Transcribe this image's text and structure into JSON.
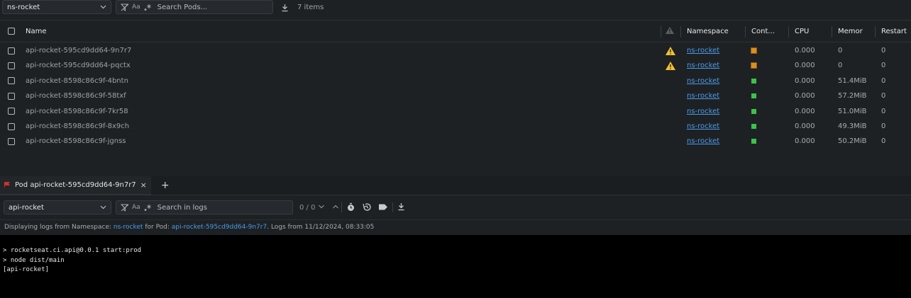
{
  "top_toolbar": {
    "namespace_select": "ns-rocket",
    "search_placeholder": "Search Pods...",
    "aa_label": "Aa",
    "items_count": "7 items"
  },
  "table": {
    "columns": {
      "name": "Name",
      "namespace": "Namespace",
      "containers": "Cont...",
      "cpu": "CPU",
      "memory": "Memor",
      "restart": "Restart"
    },
    "rows": [
      {
        "name": "api-rocket-595cd9dd64-9n7r7",
        "warning": true,
        "namespace": "ns-rocket",
        "status": "pending",
        "cpu": "0.000",
        "memory": "0",
        "restart": "0"
      },
      {
        "name": "api-rocket-595cd9dd64-pqctx",
        "warning": true,
        "namespace": "ns-rocket",
        "status": "pending",
        "cpu": "0.000",
        "memory": "0",
        "restart": "0"
      },
      {
        "name": "api-rocket-8598c86c9f-4bntn",
        "warning": false,
        "namespace": "ns-rocket",
        "status": "running",
        "cpu": "0.000",
        "memory": "51.4MiB",
        "restart": "0"
      },
      {
        "name": "api-rocket-8598c86c9f-58txf",
        "warning": false,
        "namespace": "ns-rocket",
        "status": "running",
        "cpu": "0.000",
        "memory": "57.2MiB",
        "restart": "0"
      },
      {
        "name": "api-rocket-8598c86c9f-7kr58",
        "warning": false,
        "namespace": "ns-rocket",
        "status": "running",
        "cpu": "0.000",
        "memory": "51.0MiB",
        "restart": "0"
      },
      {
        "name": "api-rocket-8598c86c9f-8x9ch",
        "warning": false,
        "namespace": "ns-rocket",
        "status": "running",
        "cpu": "0.000",
        "memory": "49.3MiB",
        "restart": "0"
      },
      {
        "name": "api-rocket-8598c86c9f-jgnss",
        "warning": false,
        "namespace": "ns-rocket",
        "status": "running",
        "cpu": "0.000",
        "memory": "50.2MiB",
        "restart": "0"
      }
    ]
  },
  "colors": {
    "pending": "#d9901f",
    "running": "#3cc34a",
    "warning": "#f2c12e",
    "link": "#4a9be8",
    "tab_flag": "#d03030"
  },
  "dock": {
    "tab_label": "Pod api-rocket-595cd9dd64-9n7r7",
    "close_glyph": "×",
    "add_glyph": "+"
  },
  "log_toolbar": {
    "container_select": "api-rocket",
    "search_placeholder": "Search in logs",
    "aa_label": "Aa",
    "match_count": "0 / 0"
  },
  "info_bar": {
    "prefix": "Displaying logs from Namespace: ",
    "namespace": "ns-rocket",
    "mid": " for Pod: ",
    "pod": "api-rocket-595cd9dd64-9n7r7",
    "suffix": ". Logs from 11/12/2024, 08:33:05"
  },
  "terminal": {
    "lines": [
      "> rocketseat.ci.api@0.0.1 start:prod",
      "> node dist/main",
      "[api-rocket]"
    ]
  }
}
